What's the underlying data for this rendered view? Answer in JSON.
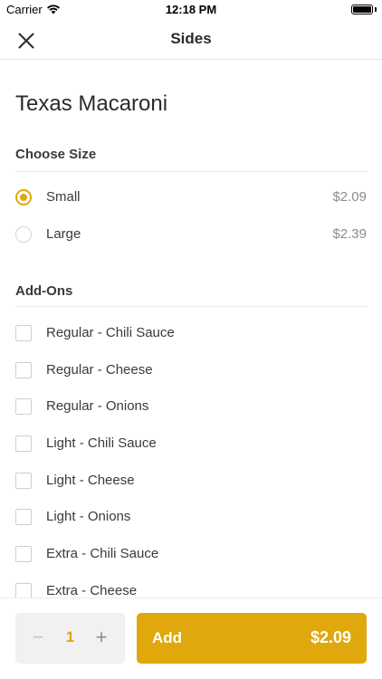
{
  "status_bar": {
    "carrier": "Carrier",
    "time": "12:18 PM"
  },
  "nav": {
    "title": "Sides",
    "close_icon": "close-icon"
  },
  "item": {
    "title": "Texas Macaroni"
  },
  "size_section": {
    "header": "Choose Size",
    "options": [
      {
        "label": "Small",
        "price": "$2.09",
        "selected": true
      },
      {
        "label": "Large",
        "price": "$2.39",
        "selected": false
      }
    ]
  },
  "addons_section": {
    "header": "Add-Ons",
    "options": [
      {
        "label": "Regular - Chili Sauce",
        "checked": false
      },
      {
        "label": "Regular - Cheese",
        "checked": false
      },
      {
        "label": "Regular - Onions",
        "checked": false
      },
      {
        "label": "Light - Chili Sauce",
        "checked": false
      },
      {
        "label": "Light - Cheese",
        "checked": false
      },
      {
        "label": "Light - Onions",
        "checked": false
      },
      {
        "label": "Extra - Chili Sauce",
        "checked": false
      },
      {
        "label": "Extra - Cheese",
        "checked": false
      }
    ]
  },
  "bottom_bar": {
    "quantity": "1",
    "minus_symbol": "−",
    "plus_symbol": "+",
    "add_label": "Add",
    "add_price": "$2.09"
  },
  "colors": {
    "accent": "#e0a80c",
    "text": "#2b2b2b",
    "price_text": "#8c8c8c"
  }
}
